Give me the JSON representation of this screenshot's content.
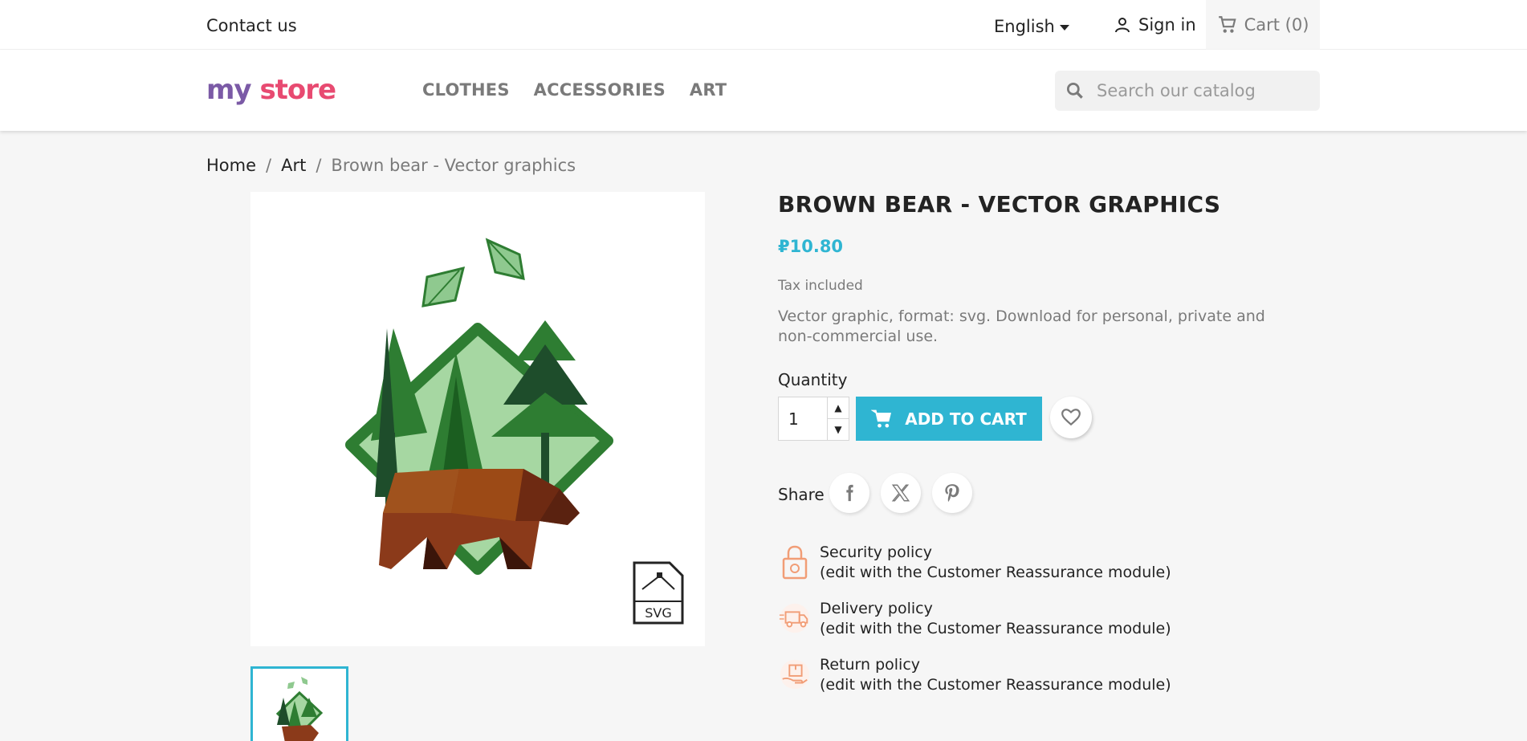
{
  "topbar": {
    "contact": "Contact us",
    "language": "English",
    "signin": "Sign in",
    "cart": "Cart (0)"
  },
  "header": {
    "logo": {
      "part1": "my",
      "part2": "store"
    },
    "nav": [
      "CLOTHES",
      "ACCESSORIES",
      "ART"
    ],
    "search_placeholder": "Search our catalog"
  },
  "breadcrumb": [
    "Home",
    "Art",
    "Brown bear - Vector graphics"
  ],
  "product": {
    "title": "BROWN BEAR - VECTOR GRAPHICS",
    "price": "₽10.80",
    "tax": "Tax included",
    "description": "Vector graphic, format: svg. Download for personal, private and non-commercial use.",
    "quantity_label": "Quantity",
    "quantity_value": "1",
    "add_to_cart": "ADD TO CART",
    "share_label": "Share",
    "svg_badge": "SVG"
  },
  "reassurance": [
    {
      "title": "Security policy",
      "subtitle": "(edit with the Customer Reassurance module)"
    },
    {
      "title": "Delivery policy",
      "subtitle": "(edit with the Customer Reassurance module)"
    },
    {
      "title": "Return policy",
      "subtitle": "(edit with the Customer Reassurance module)"
    }
  ],
  "colors": {
    "accent": "#2fb5d2",
    "muted": "#7a7a7a",
    "reassurance_icon": "#f19d76"
  }
}
